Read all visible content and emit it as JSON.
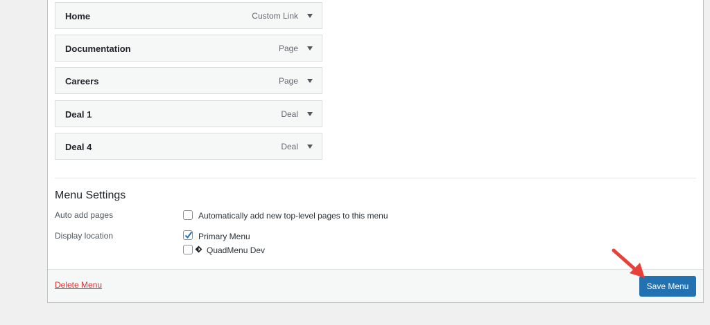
{
  "menu_items": [
    {
      "title": "Home",
      "type": "Custom Link"
    },
    {
      "title": "Documentation",
      "type": "Page"
    },
    {
      "title": "Careers",
      "type": "Page"
    },
    {
      "title": "Deal 1",
      "type": "Deal"
    },
    {
      "title": "Deal 4",
      "type": "Deal"
    }
  ],
  "settings": {
    "title": "Menu Settings",
    "auto_add_label": "Auto add pages",
    "auto_add_option": "Automatically add new top-level pages to this menu",
    "auto_add_checked": false,
    "display_location_label": "Display location",
    "locations": [
      {
        "label": "Primary Menu",
        "checked": true
      },
      {
        "label": "QuadMenu Dev",
        "checked": false,
        "icon": "diamond-icon"
      }
    ]
  },
  "footer": {
    "delete_label": "Delete Menu",
    "save_label": "Save Menu"
  },
  "colors": {
    "accent": "#2271b1",
    "delete": "#d63638",
    "annotation_arrow": "#e8413a"
  }
}
